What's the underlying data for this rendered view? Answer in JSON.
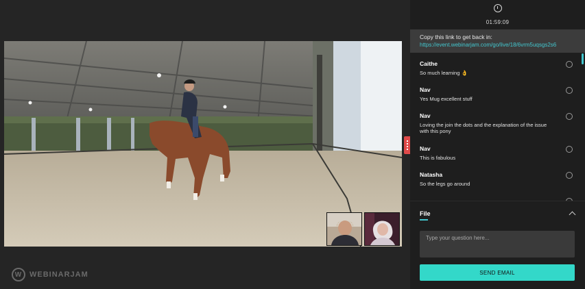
{
  "timer": {
    "value": "01:59:09",
    "icon": "clock-icon"
  },
  "rejoin": {
    "title": "Copy this link to get back in:",
    "link": "https://event.webinarjam.com/go/live/18/6vrm5uqsgs2s6"
  },
  "chat": {
    "messages": [
      {
        "name": "Caithe",
        "text": "So much learning 👌"
      },
      {
        "name": "Nav",
        "text": "Yes Mug excellent stuff"
      },
      {
        "name": "Nav",
        "text": "Loving the join the dots and the explanation of the issue with this pony"
      },
      {
        "name": "Nav",
        "text": "This is fabulous"
      },
      {
        "name": "Natasha",
        "text": "So the legs go around"
      }
    ]
  },
  "file_section": {
    "label": "File"
  },
  "question": {
    "placeholder": "Type your question here..."
  },
  "send_button": {
    "label": "SEND EMAIL"
  },
  "brand": {
    "name": "WEBINARJAM",
    "mark": "W"
  },
  "colors": {
    "accent": "#33d8c9",
    "link": "#43c7cf",
    "tab": "#e04a4a"
  }
}
